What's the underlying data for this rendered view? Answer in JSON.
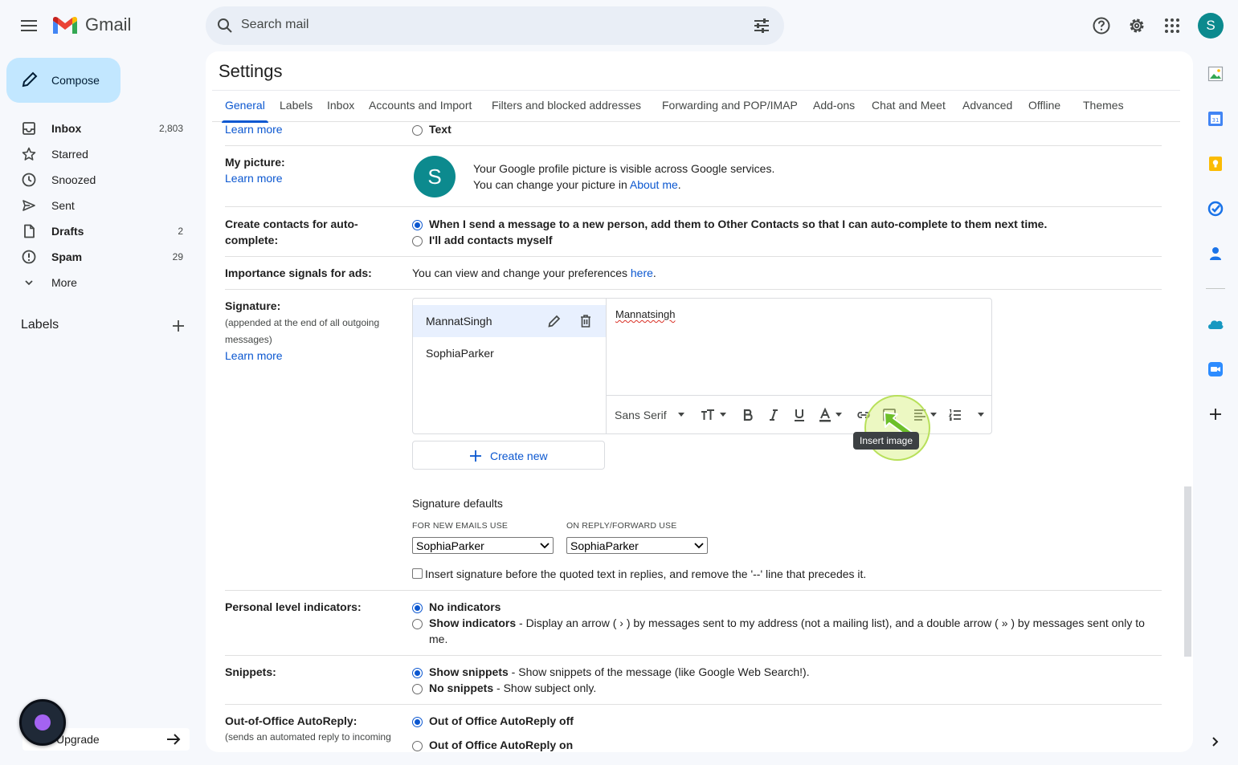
{
  "header": {
    "app_name": "Gmail",
    "search_placeholder": "Search mail",
    "avatar_letter": "S"
  },
  "nav": {
    "compose_label": "Compose",
    "items": [
      {
        "label": "Inbox",
        "count": "2,803",
        "bold": true
      },
      {
        "label": "Starred",
        "count": ""
      },
      {
        "label": "Snoozed",
        "count": ""
      },
      {
        "label": "Sent",
        "count": ""
      },
      {
        "label": "Drafts",
        "count": "2",
        "bold": true
      },
      {
        "label": "Spam",
        "count": "29",
        "bold": true
      },
      {
        "label": "More",
        "count": ""
      }
    ],
    "labels_title": "Labels",
    "upgrade_label": "Upgrade"
  },
  "settings": {
    "title": "Settings",
    "tabs": [
      "General",
      "Labels",
      "Inbox",
      "Accounts and Import",
      "Filters and blocked addresses",
      "Forwarding and POP/IMAP",
      "Add-ons",
      "Chat and Meet",
      "Advanced",
      "Offline",
      "Themes"
    ],
    "active_tab": "General",
    "learn_more": "Learn more",
    "text_option": "Text",
    "my_picture": {
      "label": "My picture:",
      "line1": "Your Google profile picture is visible across Google services.",
      "line2_prefix": "You can change your picture in ",
      "line2_link": "About me",
      "line2_suffix": ".",
      "avatar_letter": "S"
    },
    "contacts": {
      "label_line1": "Create contacts for auto-",
      "label_line2": "complete:",
      "option1": "When I send a message to a new person, add them to Other Contacts so that I can auto-complete to them next time.",
      "option2": "I'll add contacts myself"
    },
    "importance": {
      "label": "Importance signals for ads:",
      "text_prefix": "You can view and change your preferences ",
      "link": "here",
      "text_suffix": "."
    },
    "signature": {
      "label": "Signature:",
      "sub_line1": "(appended at the end of all outgoing",
      "sub_line2": "messages)",
      "list": [
        "MannatSingh",
        "SophiaParker"
      ],
      "editor_text": "Mannatsingh",
      "font_name": "Sans Serif",
      "create_new": "Create new",
      "tooltip": "Insert image",
      "defaults_title": "Signature defaults",
      "new_emails_caption": "FOR NEW EMAILS USE",
      "reply_caption": "ON REPLY/FORWARD USE",
      "new_emails_value": "SophiaParker",
      "reply_value": "SophiaParker",
      "insert_before_label": "Insert signature before the quoted text in replies, and remove the '--' line that precedes it."
    },
    "personal_level": {
      "label": "Personal level indicators:",
      "option1": "No indicators",
      "option2_bold": "Show indicators",
      "option2_rest": " - Display an arrow ( › ) by messages sent to my address (not a mailing list), and a double arrow ( » ) by messages sent only to",
      "option2_wrap": "me."
    },
    "snippets": {
      "label": "Snippets:",
      "option1_bold": "Show snippets",
      "option1_rest": " - Show snippets of the message (like Google Web Search!).",
      "option2_bold": "No snippets",
      "option2_rest": " - Show subject only."
    },
    "autoreply": {
      "label": "Out-of-Office AutoReply:",
      "sub": "(sends an automated reply to incoming",
      "option1": "Out of Office AutoReply off",
      "option2": "Out of Office AutoReply on"
    }
  },
  "colors": {
    "accent": "#0b57d0",
    "compose_bg": "#c2e7ff",
    "avatar": "#0c8a8e"
  }
}
